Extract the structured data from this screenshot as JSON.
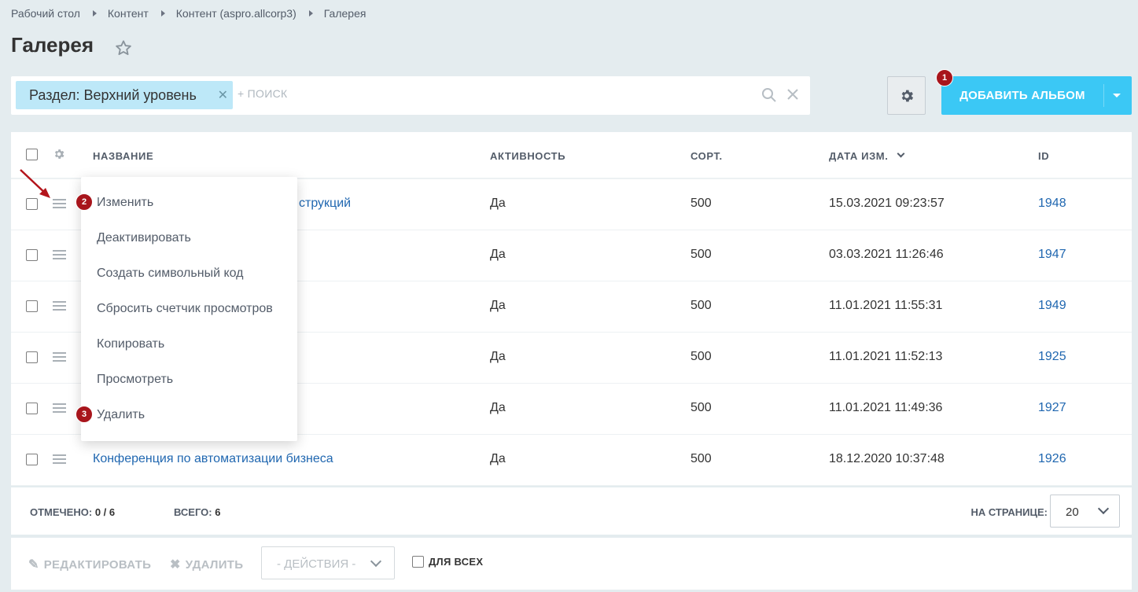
{
  "breadcrumb": [
    "Рабочий стол",
    "Контент",
    "Контент (aspro.allcorp3)",
    "Галерея"
  ],
  "page_title": "Галерея",
  "filter": {
    "chip_label": "Раздел: Верхний уровень",
    "search_placeholder": "+ поиск"
  },
  "add_button": {
    "label": "ДОБАВИТЬ АЛЬБОМ"
  },
  "badges": {
    "b1": "1",
    "b2": "2",
    "b3": "3"
  },
  "table": {
    "columns": {
      "name": "НАЗВАНИЕ",
      "active": "АКТИВНОСТЬ",
      "sort": "СОРТ.",
      "date": "ДАТА ИЗМ.",
      "id": "ID"
    },
    "rows": [
      {
        "name": "струкций",
        "active": "Да",
        "sort": "500",
        "date": "15.03.2021 09:23:57",
        "id": "1948"
      },
      {
        "name": "",
        "active": "Да",
        "sort": "500",
        "date": "03.03.2021 11:26:46",
        "id": "1947"
      },
      {
        "name": "",
        "active": "Да",
        "sort": "500",
        "date": "11.01.2021 11:55:31",
        "id": "1949"
      },
      {
        "name": "",
        "active": "Да",
        "sort": "500",
        "date": "11.01.2021 11:52:13",
        "id": "1925"
      },
      {
        "name": "",
        "active": "Да",
        "sort": "500",
        "date": "11.01.2021 11:49:36",
        "id": "1927"
      },
      {
        "name": "Конференция по автоматизации бизнеса",
        "active": "Да",
        "sort": "500",
        "date": "18.12.2020 10:37:48",
        "id": "1926"
      }
    ]
  },
  "context_menu": [
    "Изменить",
    "Деактивировать",
    "Создать символьный код",
    "Сбросить счетчик просмотров",
    "Копировать",
    "Просмотреть",
    "Удалить"
  ],
  "footer": {
    "checked_label": "ОТМЕЧЕНО:",
    "checked_value": "0 / 6",
    "total_label": "ВСЕГО:",
    "total_value": "6",
    "per_page_label": "НА СТРАНИЦЕ:",
    "per_page_value": "20"
  },
  "actions": {
    "edit": "РЕДАКТИРОВАТЬ",
    "delete": "УДАЛИТЬ",
    "select": "- ДЕЙСТВИЯ -",
    "for_all": "ДЛЯ ВСЕХ"
  },
  "colors": {
    "accent": "#3bc8f5",
    "badge": "#a8151c",
    "link": "#2067b0",
    "chip": "#bde8f8"
  }
}
